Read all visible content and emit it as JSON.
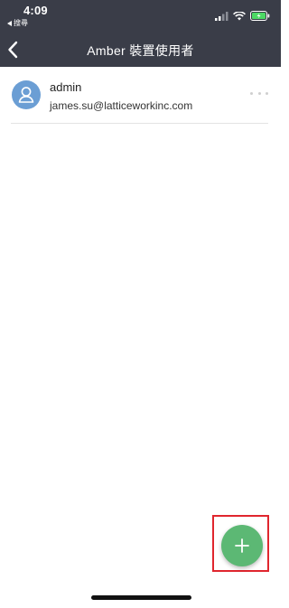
{
  "status_bar": {
    "time": "4:09",
    "back_app_label": "搜尋",
    "battery_color": "#4cd964"
  },
  "nav": {
    "title": "Amber 裝置使用者",
    "back_icon": "chevron-left-icon"
  },
  "users": [
    {
      "name": "admin",
      "email": "james.su@latticeworkinc.com",
      "avatar_icon": "person-icon",
      "avatar_color": "#6b9ed4",
      "more_icon": "more-horizontal-icon"
    }
  ],
  "fab": {
    "icon": "plus-icon",
    "color": "#5cb874",
    "highlight_color": "#e0262e"
  }
}
